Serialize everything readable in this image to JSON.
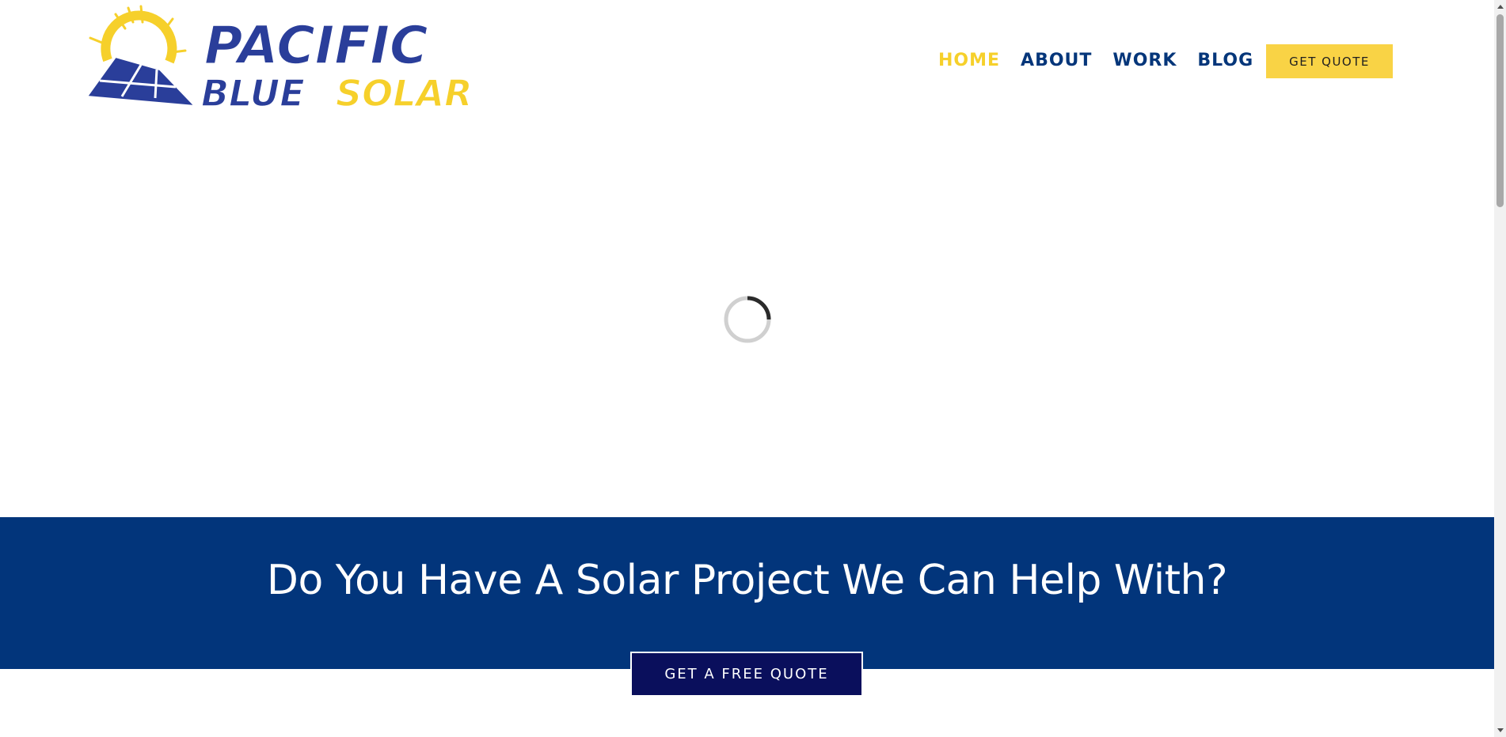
{
  "brand": {
    "logo_line1": "PACIFIC",
    "logo_line2a": "BLUE",
    "logo_line2b": "SOLAR",
    "colors": {
      "blue": "#2a3e9a",
      "yellow": "#f6d02b",
      "navy": "#05367a"
    }
  },
  "nav": {
    "items": [
      {
        "label": "HOME",
        "active": true
      },
      {
        "label": "ABOUT",
        "active": false
      },
      {
        "label": "WORK",
        "active": false
      },
      {
        "label": "BLOG",
        "active": false
      }
    ],
    "quote_button": "GET QUOTE"
  },
  "hero": {
    "loading_icon": "spinner-icon"
  },
  "cta": {
    "heading": "Do You Have A Solar Project We Can Help With?",
    "button": "GET A FREE QUOTE",
    "band_color": "#02357b",
    "button_color": "#0a0f5c"
  }
}
